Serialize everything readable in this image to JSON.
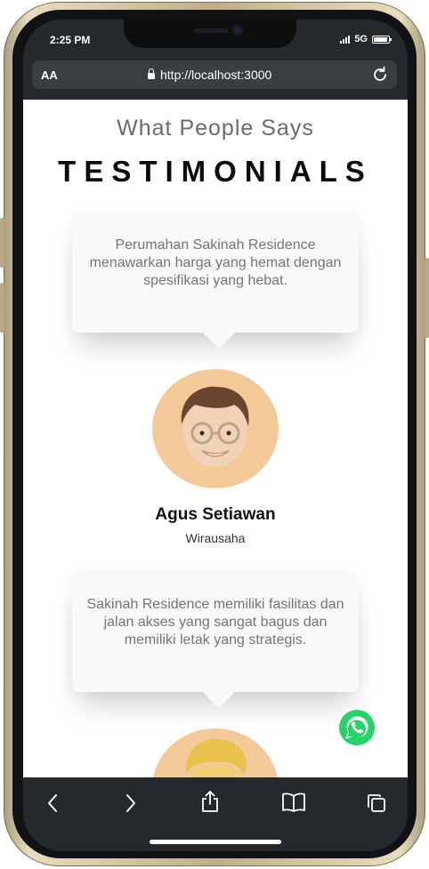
{
  "status_bar": {
    "time": "2:25 PM",
    "network": "5G"
  },
  "browser": {
    "text_size_label": "AA",
    "url": "http://localhost:3000"
  },
  "section": {
    "subtitle": "What People Says",
    "title": "TESTIMONIALS"
  },
  "testimonials": [
    {
      "quote": "Perumahan Sakinah Residence menawarkan harga yang hemat dengan spesifikasi yang hebat.",
      "name": "Agus Setiawan",
      "role": "Wirausaha"
    },
    {
      "quote": "Sakinah Residence memiliki fasilitas dan jalan akses yang sangat bagus dan memiliki letak yang strategis."
    }
  ],
  "colors": {
    "accent_avatar": "#f3c998",
    "whatsapp": "#25d366",
    "browser_chrome": "#26292b"
  },
  "icons": [
    "lock-icon",
    "reload-icon",
    "whatsapp-icon",
    "back-icon",
    "forward-icon",
    "share-icon",
    "bookmarks-icon",
    "tabs-icon"
  ]
}
